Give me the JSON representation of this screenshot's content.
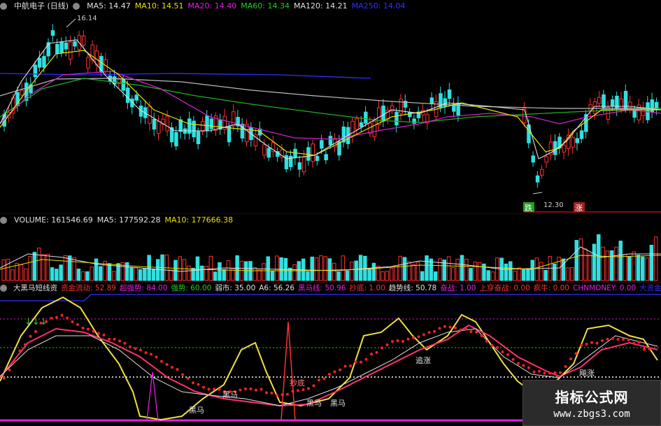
{
  "price_panel": {
    "legend": [
      {
        "text": "中航电子 (日线)",
        "color": "#e0e0e0"
      },
      {
        "text": "MA5: 14.47",
        "color": "#e0e0e0"
      },
      {
        "text": "MA10: 14.51",
        "color": "#e8e000"
      },
      {
        "text": "MA20: 14.40",
        "color": "#e020e0"
      },
      {
        "text": "MA60: 14.34",
        "color": "#20d020"
      },
      {
        "text": "MA120: 14.21",
        "color": "#e0e0e0"
      },
      {
        "text": "MA250: 14.04",
        "color": "#3030ff"
      }
    ],
    "high_label": "16.14",
    "low_label": "12.30",
    "signal_down": "跌",
    "signal_up": "涨"
  },
  "volume_panel": {
    "legend": [
      {
        "text": "VOLUME: 161546.69",
        "color": "#e0e0e0"
      },
      {
        "text": "MA5: 177592.28",
        "color": "#e0e0e0"
      },
      {
        "text": "MA10: 177666.38",
        "color": "#e8e000"
      }
    ]
  },
  "indicator_panel": {
    "legend": [
      {
        "text": "大黑马短线资",
        "color": "#e0e0e0"
      },
      {
        "text": "资金流动: 52.89",
        "color": "#ff3030"
      },
      {
        "text": "超强势: 84.00",
        "color": "#e020e0"
      },
      {
        "text": "强势: 60.00",
        "color": "#20d020"
      },
      {
        "text": "弱市: 35.00",
        "color": "#e0e0e0"
      },
      {
        "text": "A6: 56.26",
        "color": "#e0e0e0"
      },
      {
        "text": "黑马线: 50.96",
        "color": "#e020e0"
      },
      {
        "text": "抄底: 1.00",
        "color": "#ff3030"
      },
      {
        "text": "趋势线: 50.78",
        "color": "#e0e0e0"
      },
      {
        "text": "奋战: 1.00",
        "color": "#e020e0"
      },
      {
        "text": "上穿奋战: 0.00",
        "color": "#ff3030"
      },
      {
        "text": "疯牛: 0.00",
        "color": "#ff3030"
      },
      {
        "text": "CHNMONEY: 0.00",
        "color": "#e020e0"
      },
      {
        "text": "大资金",
        "color": "#3030ff"
      }
    ],
    "labels": {
      "chaodi": "抄底",
      "heima1": "黑马",
      "heima2": "黑马",
      "heima3": "黑马",
      "heima4": "黑马",
      "zhuizhang": "追涨",
      "bazhang": "飚涨"
    }
  },
  "watermark": {
    "title": "指标公式网",
    "url": "www.zbgs3.com"
  }
}
